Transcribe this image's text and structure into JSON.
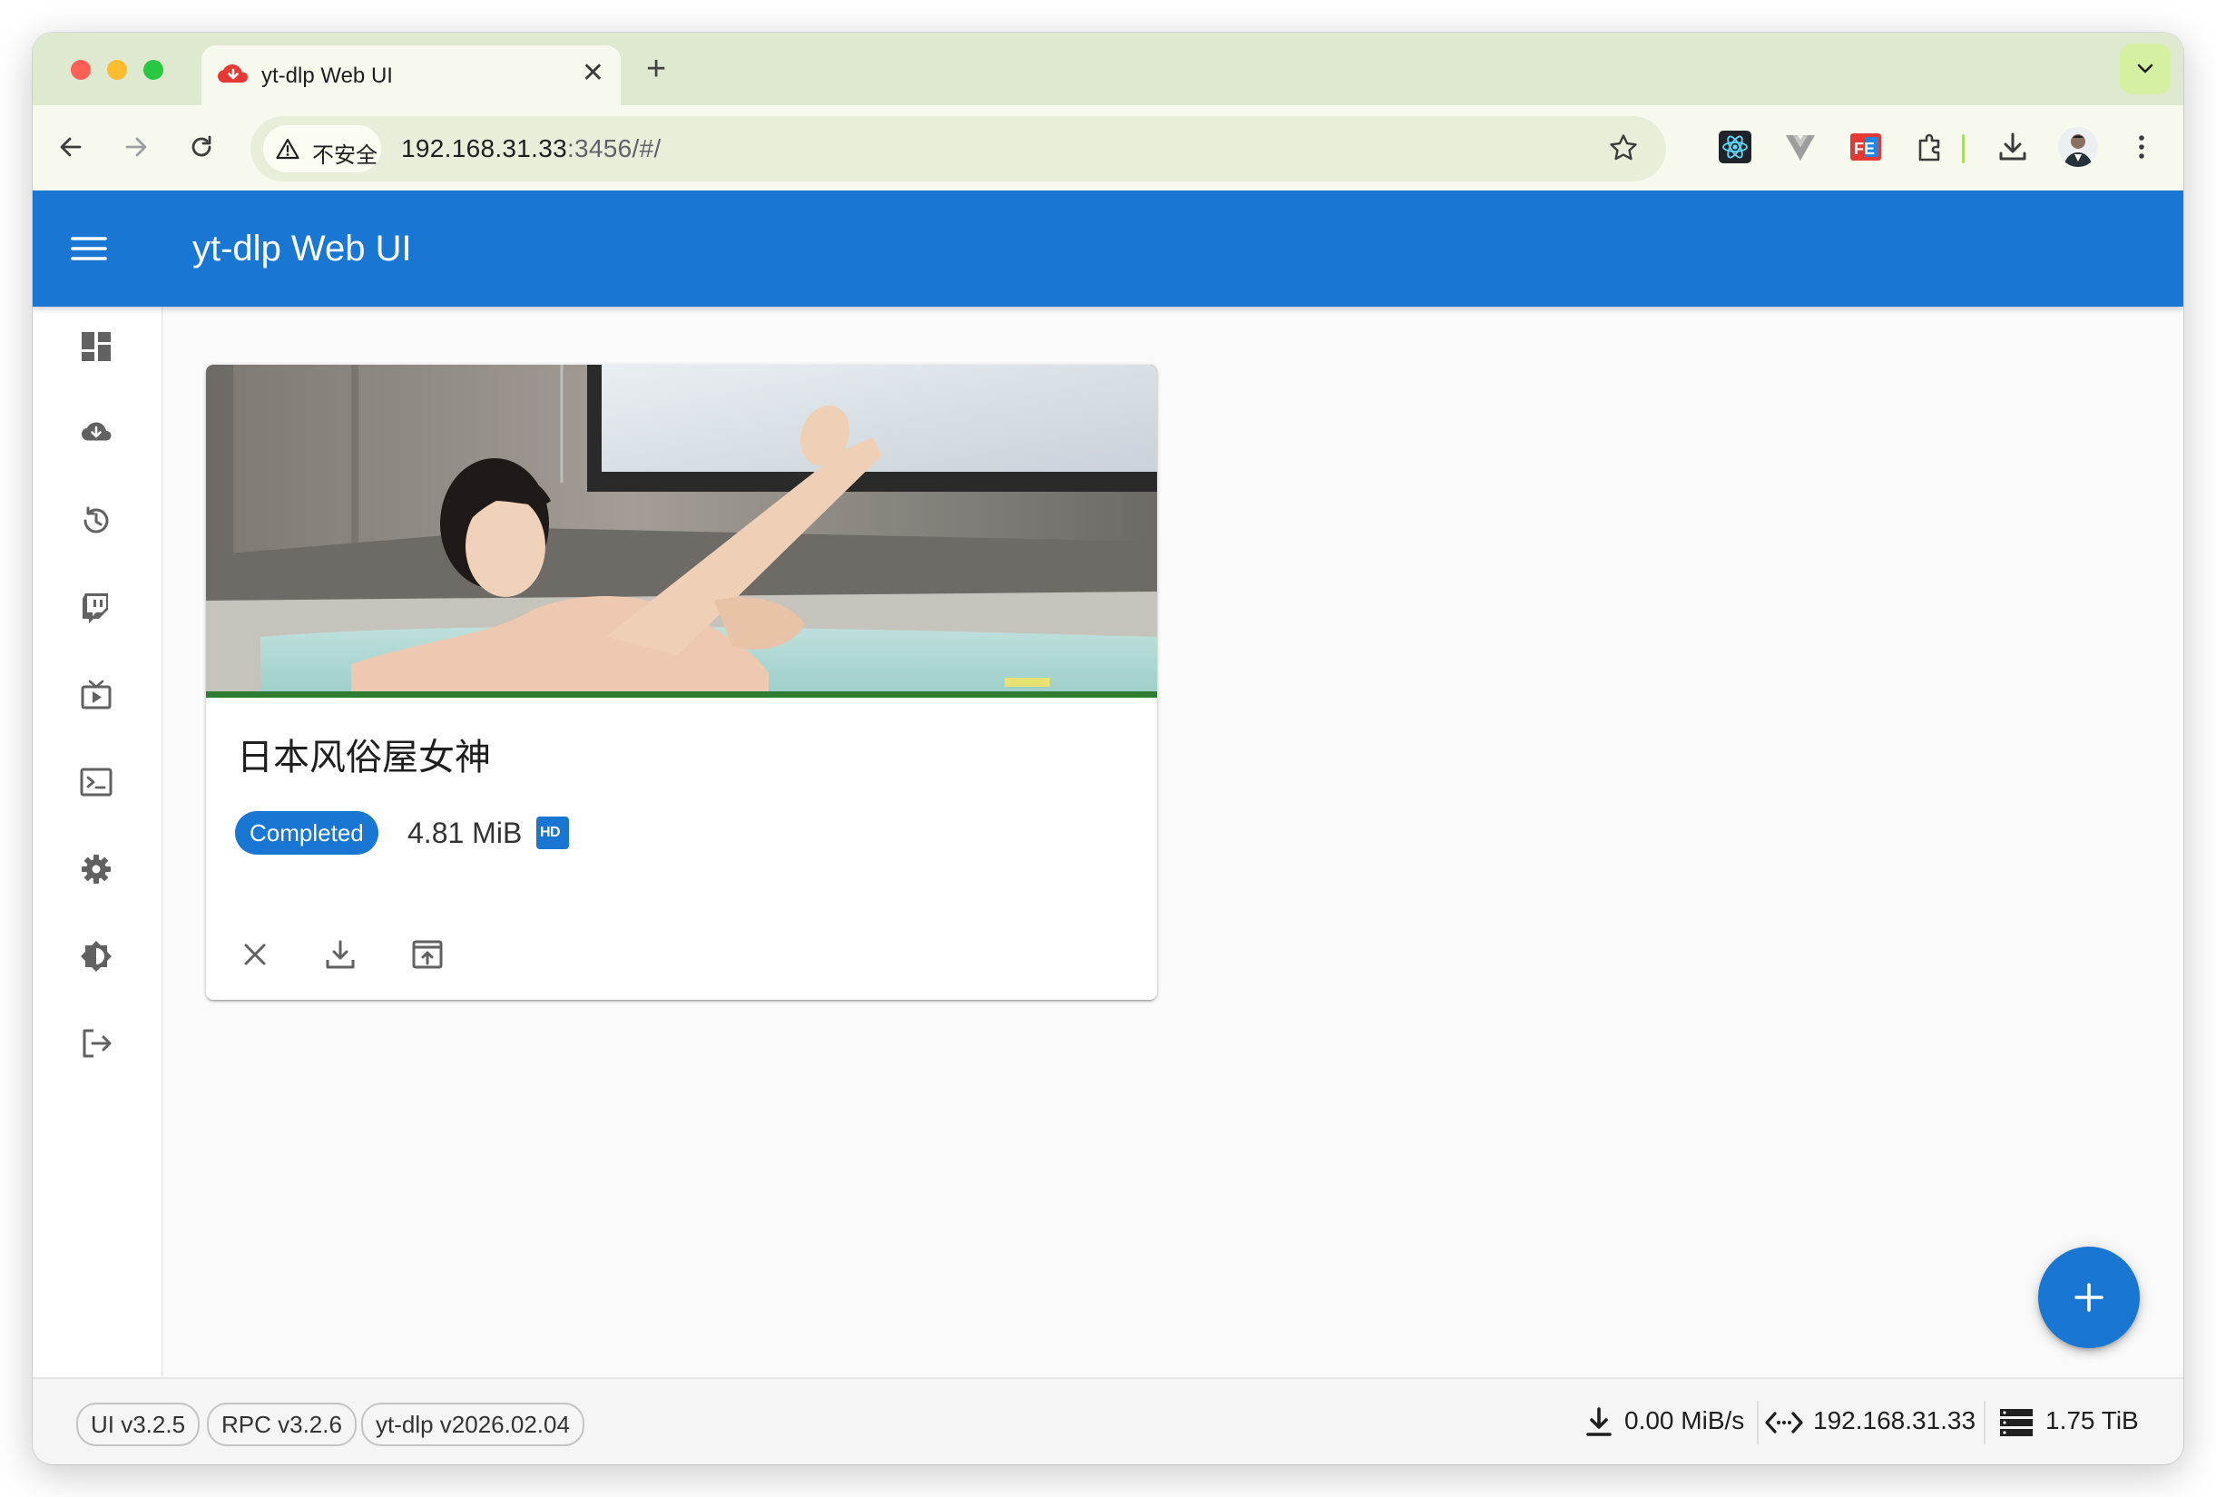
{
  "browser": {
    "tab_title": "yt-dlp Web UI",
    "tab_close": "✕",
    "new_tab": "+",
    "security_label": "不安全",
    "url_host": "192.168.31.33",
    "url_rest": ":3456/#/"
  },
  "app": {
    "title": "yt-dlp Web UI",
    "brand_color": "#1976d2"
  },
  "sidebar": {
    "items": [
      {
        "icon": "dashboard-icon"
      },
      {
        "icon": "cloud-download-icon"
      },
      {
        "icon": "history-icon"
      },
      {
        "icon": "twitch-icon"
      },
      {
        "icon": "subscriptions-tv-icon"
      },
      {
        "icon": "terminal-icon"
      },
      {
        "icon": "settings-icon"
      },
      {
        "icon": "theme-toggle-icon"
      },
      {
        "icon": "logout-icon"
      }
    ]
  },
  "downloads": [
    {
      "title": "日本风俗屋女神",
      "status": "Completed",
      "size": "4.81 MiB",
      "quality_badge": "HD",
      "progress": 1.0,
      "actions": [
        "close-icon",
        "download-icon",
        "open-in-new-icon"
      ]
    }
  ],
  "footer": {
    "versions": [
      "UI v3.2.5",
      "RPC v3.2.6",
      "yt-dlp v2026.02.04"
    ],
    "download_speed": "0.00 MiB/s",
    "server_address": "192.168.31.33",
    "free_space": "1.75 TiB"
  }
}
